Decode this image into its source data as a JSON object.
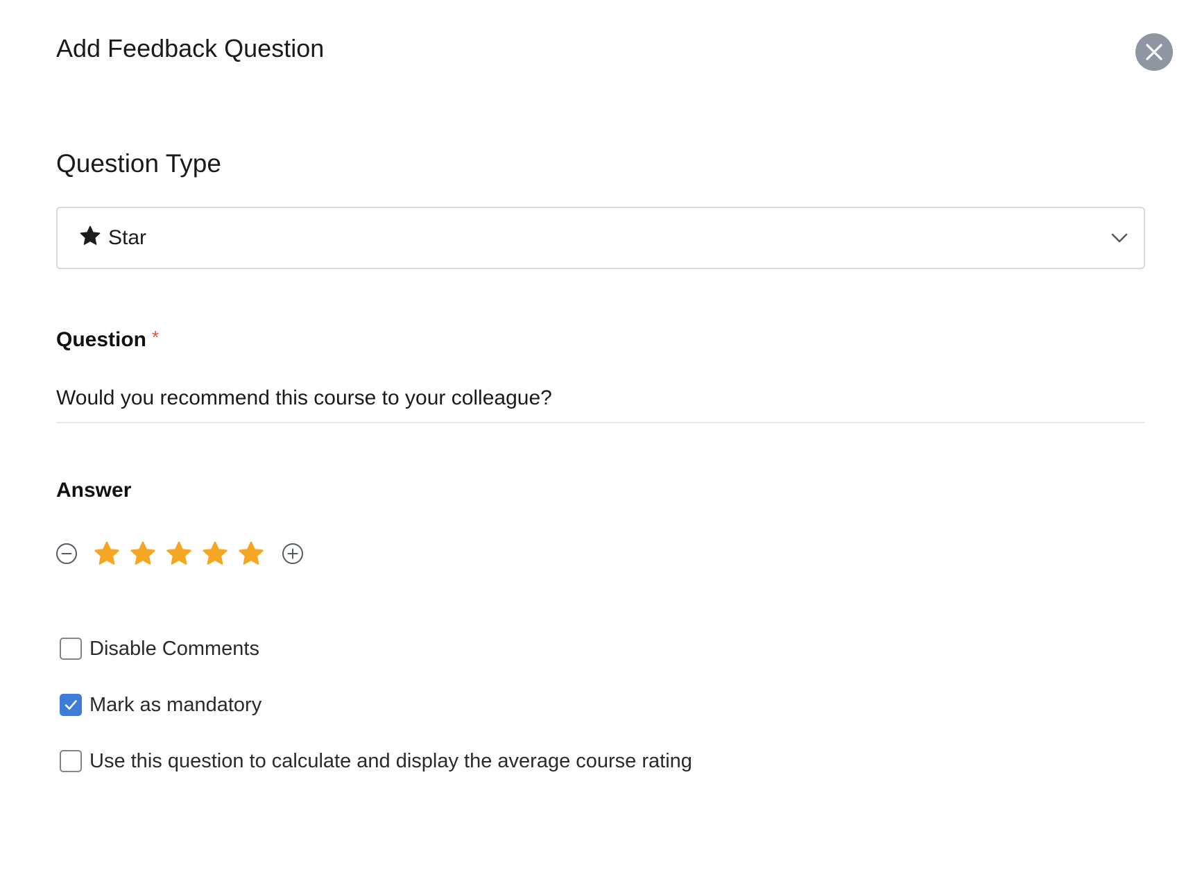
{
  "modal": {
    "title": "Add Feedback Question",
    "close_icon": "close-icon"
  },
  "question_type": {
    "section_title": "Question Type",
    "selected_value": "Star",
    "selected_icon": "star-icon",
    "dropdown_icon": "chevron-down-icon"
  },
  "question": {
    "label": "Question",
    "required_marker": "*",
    "value": "Would you recommend this course to your colleague?"
  },
  "answer": {
    "label": "Answer",
    "star_count": 5,
    "star_color": "#F5A623",
    "decrease_icon": "minus-circle-icon",
    "increase_icon": "plus-circle-icon"
  },
  "options": [
    {
      "label": "Disable Comments",
      "checked": false
    },
    {
      "label": "Mark as mandatory",
      "checked": true
    },
    {
      "label": "Use this question to calculate and display the average course rating",
      "checked": false
    }
  ],
  "colors": {
    "checkbox_checked": "#3F7BD8",
    "required": "#E0563B",
    "close_button_bg": "#8D96A1"
  }
}
